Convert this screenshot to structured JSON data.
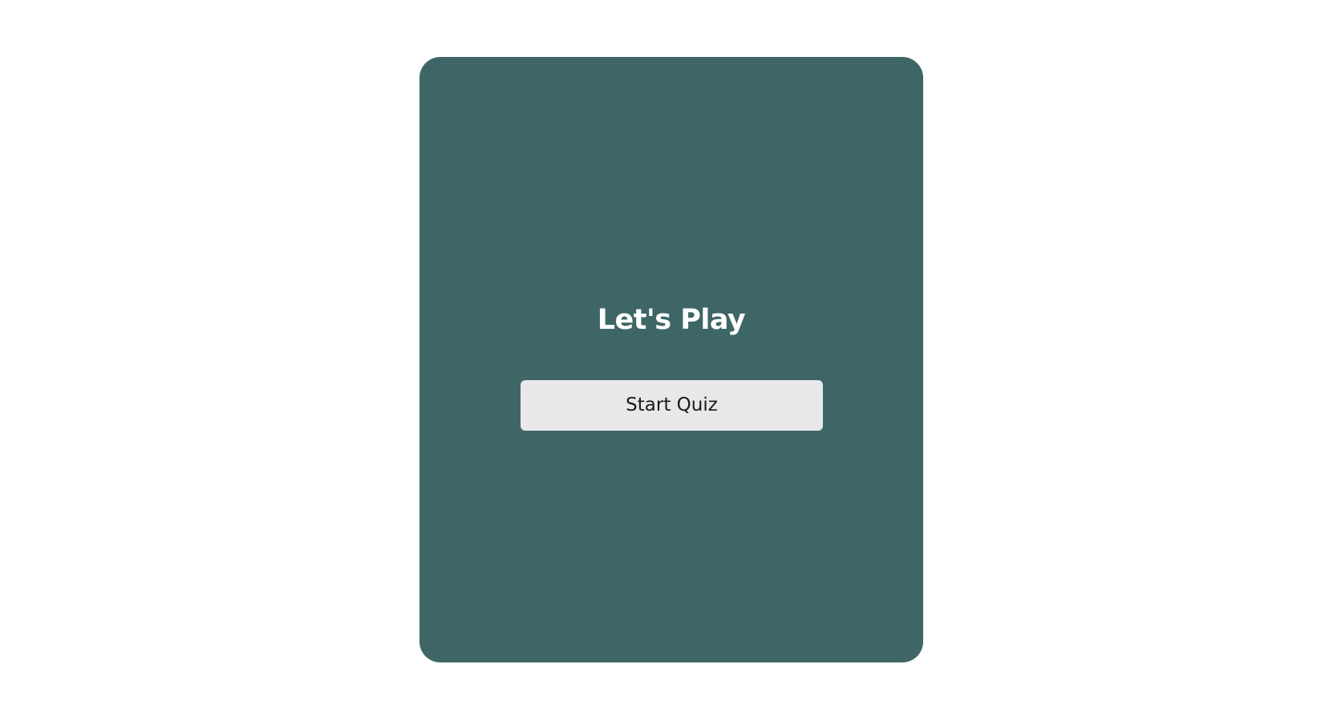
{
  "card": {
    "title": "Let's Play",
    "start_button_label": "Start Quiz"
  },
  "colors": {
    "page_background": "#ffffff",
    "card_background": "#3f6667",
    "title_text": "#ffffff",
    "button_background": "#e8e8eb",
    "button_text": "#1a1a1a"
  }
}
